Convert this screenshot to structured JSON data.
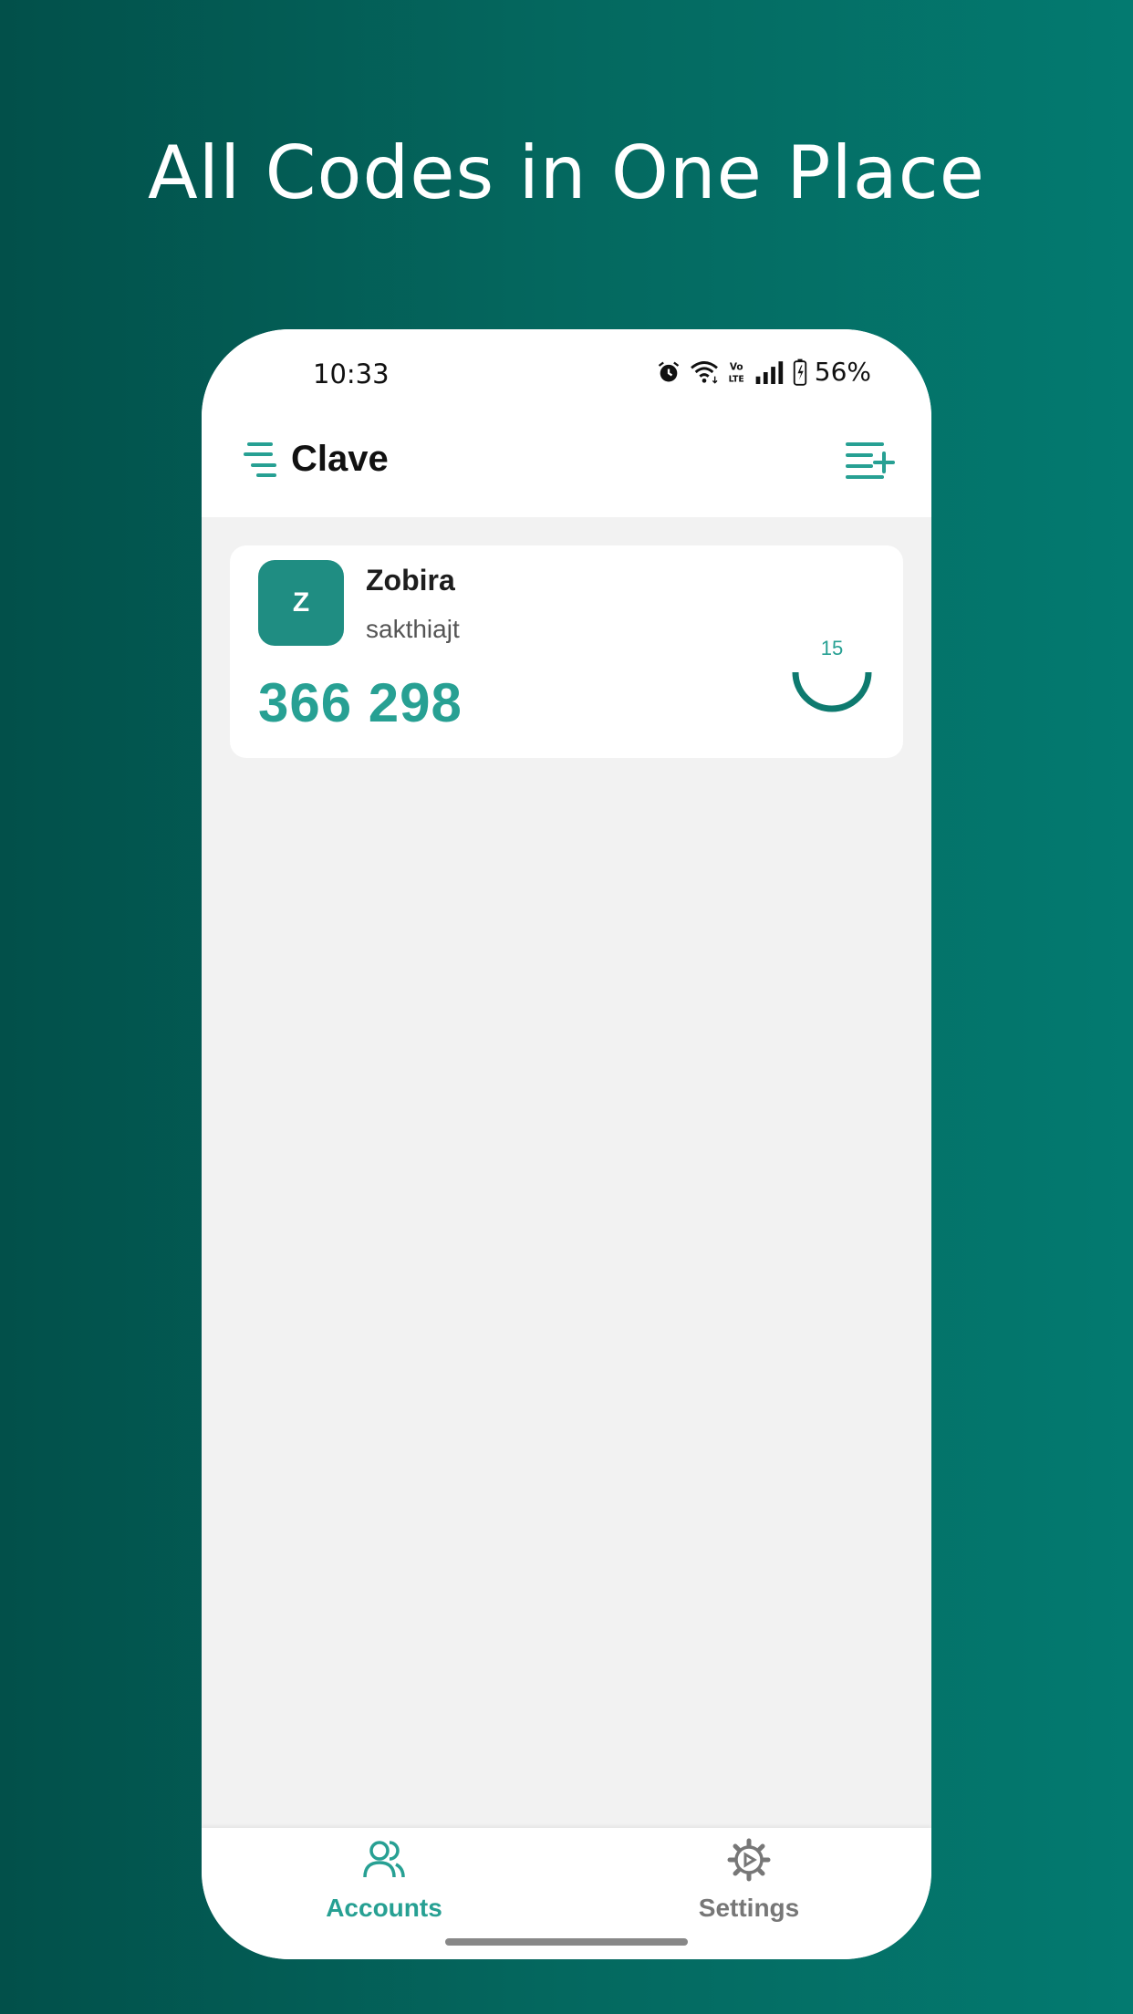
{
  "headline": "All Codes in One Place",
  "status_bar": {
    "time": "10:33",
    "battery": "56%"
  },
  "app_bar": {
    "title": "Clave"
  },
  "account": {
    "initial": "Z",
    "name": "Zobira",
    "username": "sakthiajt",
    "code": "366 298",
    "seconds_remaining": "15",
    "period_fraction": 0.5
  },
  "nav": {
    "accounts_label": "Accounts",
    "settings_label": "Settings"
  },
  "colors": {
    "accent": "#27a093",
    "avatar": "#1f8d82",
    "background_gradient_start": "#02504a",
    "background_gradient_end": "#037a70"
  }
}
